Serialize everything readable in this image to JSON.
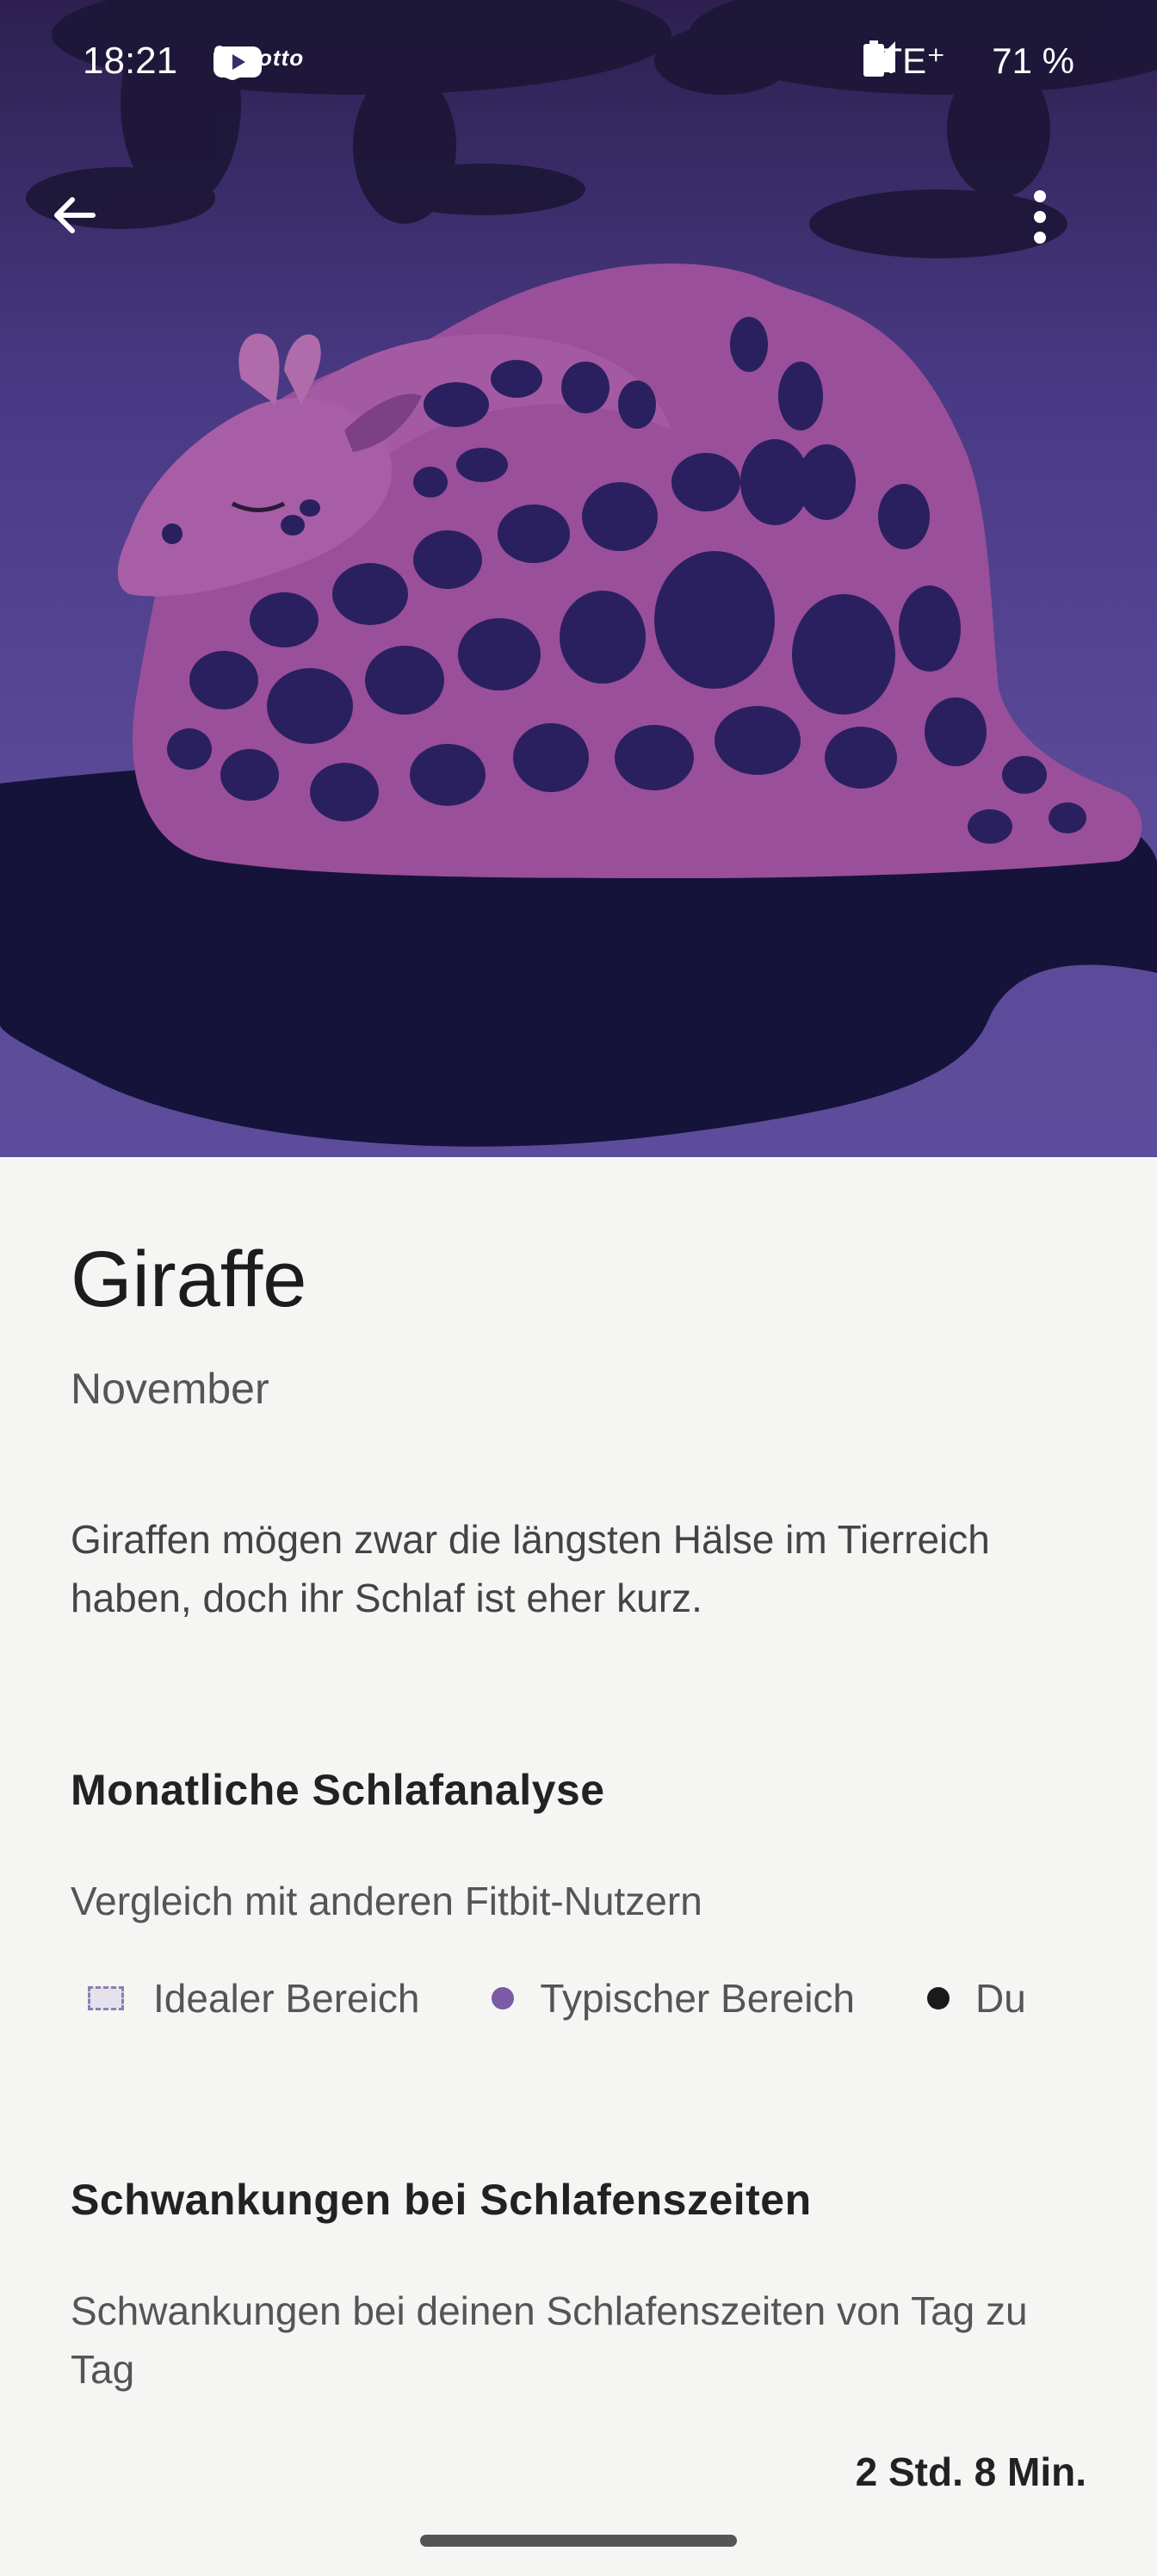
{
  "status_bar": {
    "time": "18:21",
    "network": "LTE⁺",
    "battery": "71 %",
    "notification_icons": [
      "snapchat-icon",
      "discord-icon",
      "otto-icon",
      "youtube-icon",
      "dot-icon"
    ]
  },
  "toolbar": {
    "back_icon": "arrow-back-icon",
    "more_icon": "more-vertical-icon"
  },
  "hero": {
    "illustration": "sleeping-giraffe-illustration",
    "colors": {
      "sky_top": "#2d2050",
      "sky_bottom": "#5d4c9b",
      "giraffe": "#9a4f9a",
      "spots": "#2a2060",
      "shadow": "#15133a"
    }
  },
  "profile": {
    "title": "Giraffe",
    "month": "November",
    "description": "Giraffen mögen zwar die längsten Hälse im Tierreich haben, doch ihr Schlaf ist eher kurz."
  },
  "monthly_analysis": {
    "title": "Monatliche Schlafanalyse",
    "subtitle": "Vergleich mit anderen Fitbit-Nutzern",
    "legend": [
      {
        "label": "Idealer Bereich",
        "color": "#e5e2ee"
      },
      {
        "label": "Typischer Bereich",
        "color": "#7b5aa6"
      },
      {
        "label": "Du",
        "color": "#1a1a1a"
      }
    ]
  },
  "bedtime_variability": {
    "title": "Schwankungen bei Schlafenszeiten",
    "subtitle": "Schwankungen bei deinen Schlafenszeiten von Tag zu Tag",
    "value": "2 Std. 8 Min."
  }
}
